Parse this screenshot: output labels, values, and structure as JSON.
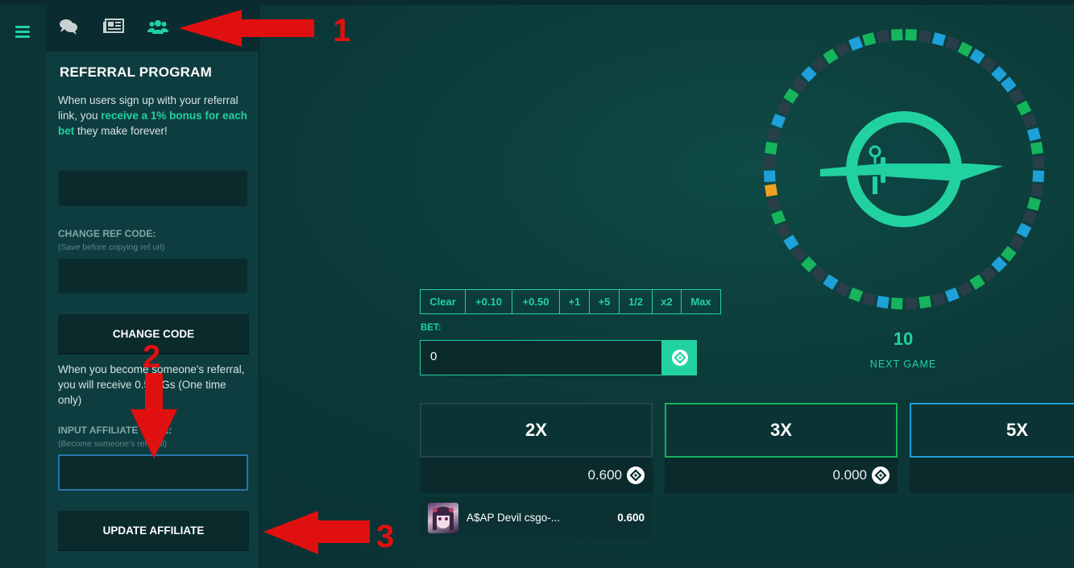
{
  "nav": {
    "menu_icon": "hamburger-icon",
    "tabs": [
      {
        "icon": "chat-icon"
      },
      {
        "icon": "news-icon"
      },
      {
        "icon": "users-icon"
      }
    ]
  },
  "referral": {
    "title": "REFERRAL PROGRAM",
    "intro_pre": "When users sign up with your referral link, you ",
    "intro_highlight": "receive a 1% bonus for each bet",
    "intro_post": " they make forever!",
    "change_label": "CHANGE REF CODE:",
    "change_hint": "(Save before copying ref url)",
    "change_button": "CHANGE CODE",
    "affiliate_desc": "When you become someone's referral, you will receive 0.5 GGs (One time only)",
    "affiliate_label": "INPUT AFFILIATE CODE:",
    "affiliate_hint": "(Become someone's referral)",
    "update_button": "UPDATE AFFILIATE"
  },
  "annotations": {
    "n1": "1",
    "n2": "2",
    "n3": "3",
    "color": "#e01010"
  },
  "bet": {
    "chips": [
      "Clear",
      "+0.10",
      "+0.50",
      "+1",
      "+5",
      "1/2",
      "x2",
      "Max"
    ],
    "label": "BET:",
    "value": "0"
  },
  "wheel": {
    "countdown": "10",
    "status": "NEXT GAME",
    "colors": {
      "dark": "#2a3e4a",
      "green": "#16b45c",
      "blue": "#1ea0d8",
      "gold": "#f0a020",
      "accent": "#21d2a0"
    }
  },
  "multipliers": [
    {
      "label": "2X",
      "total": "0.600",
      "border": "#24464a"
    },
    {
      "label": "3X",
      "total": "0.000",
      "border": "#16b45c"
    },
    {
      "label": "5X",
      "total": "",
      "border": "#1ea0d8"
    }
  ],
  "bets": [
    {
      "name": "A$AP Devil csgo-...",
      "amount": "0.600"
    }
  ]
}
